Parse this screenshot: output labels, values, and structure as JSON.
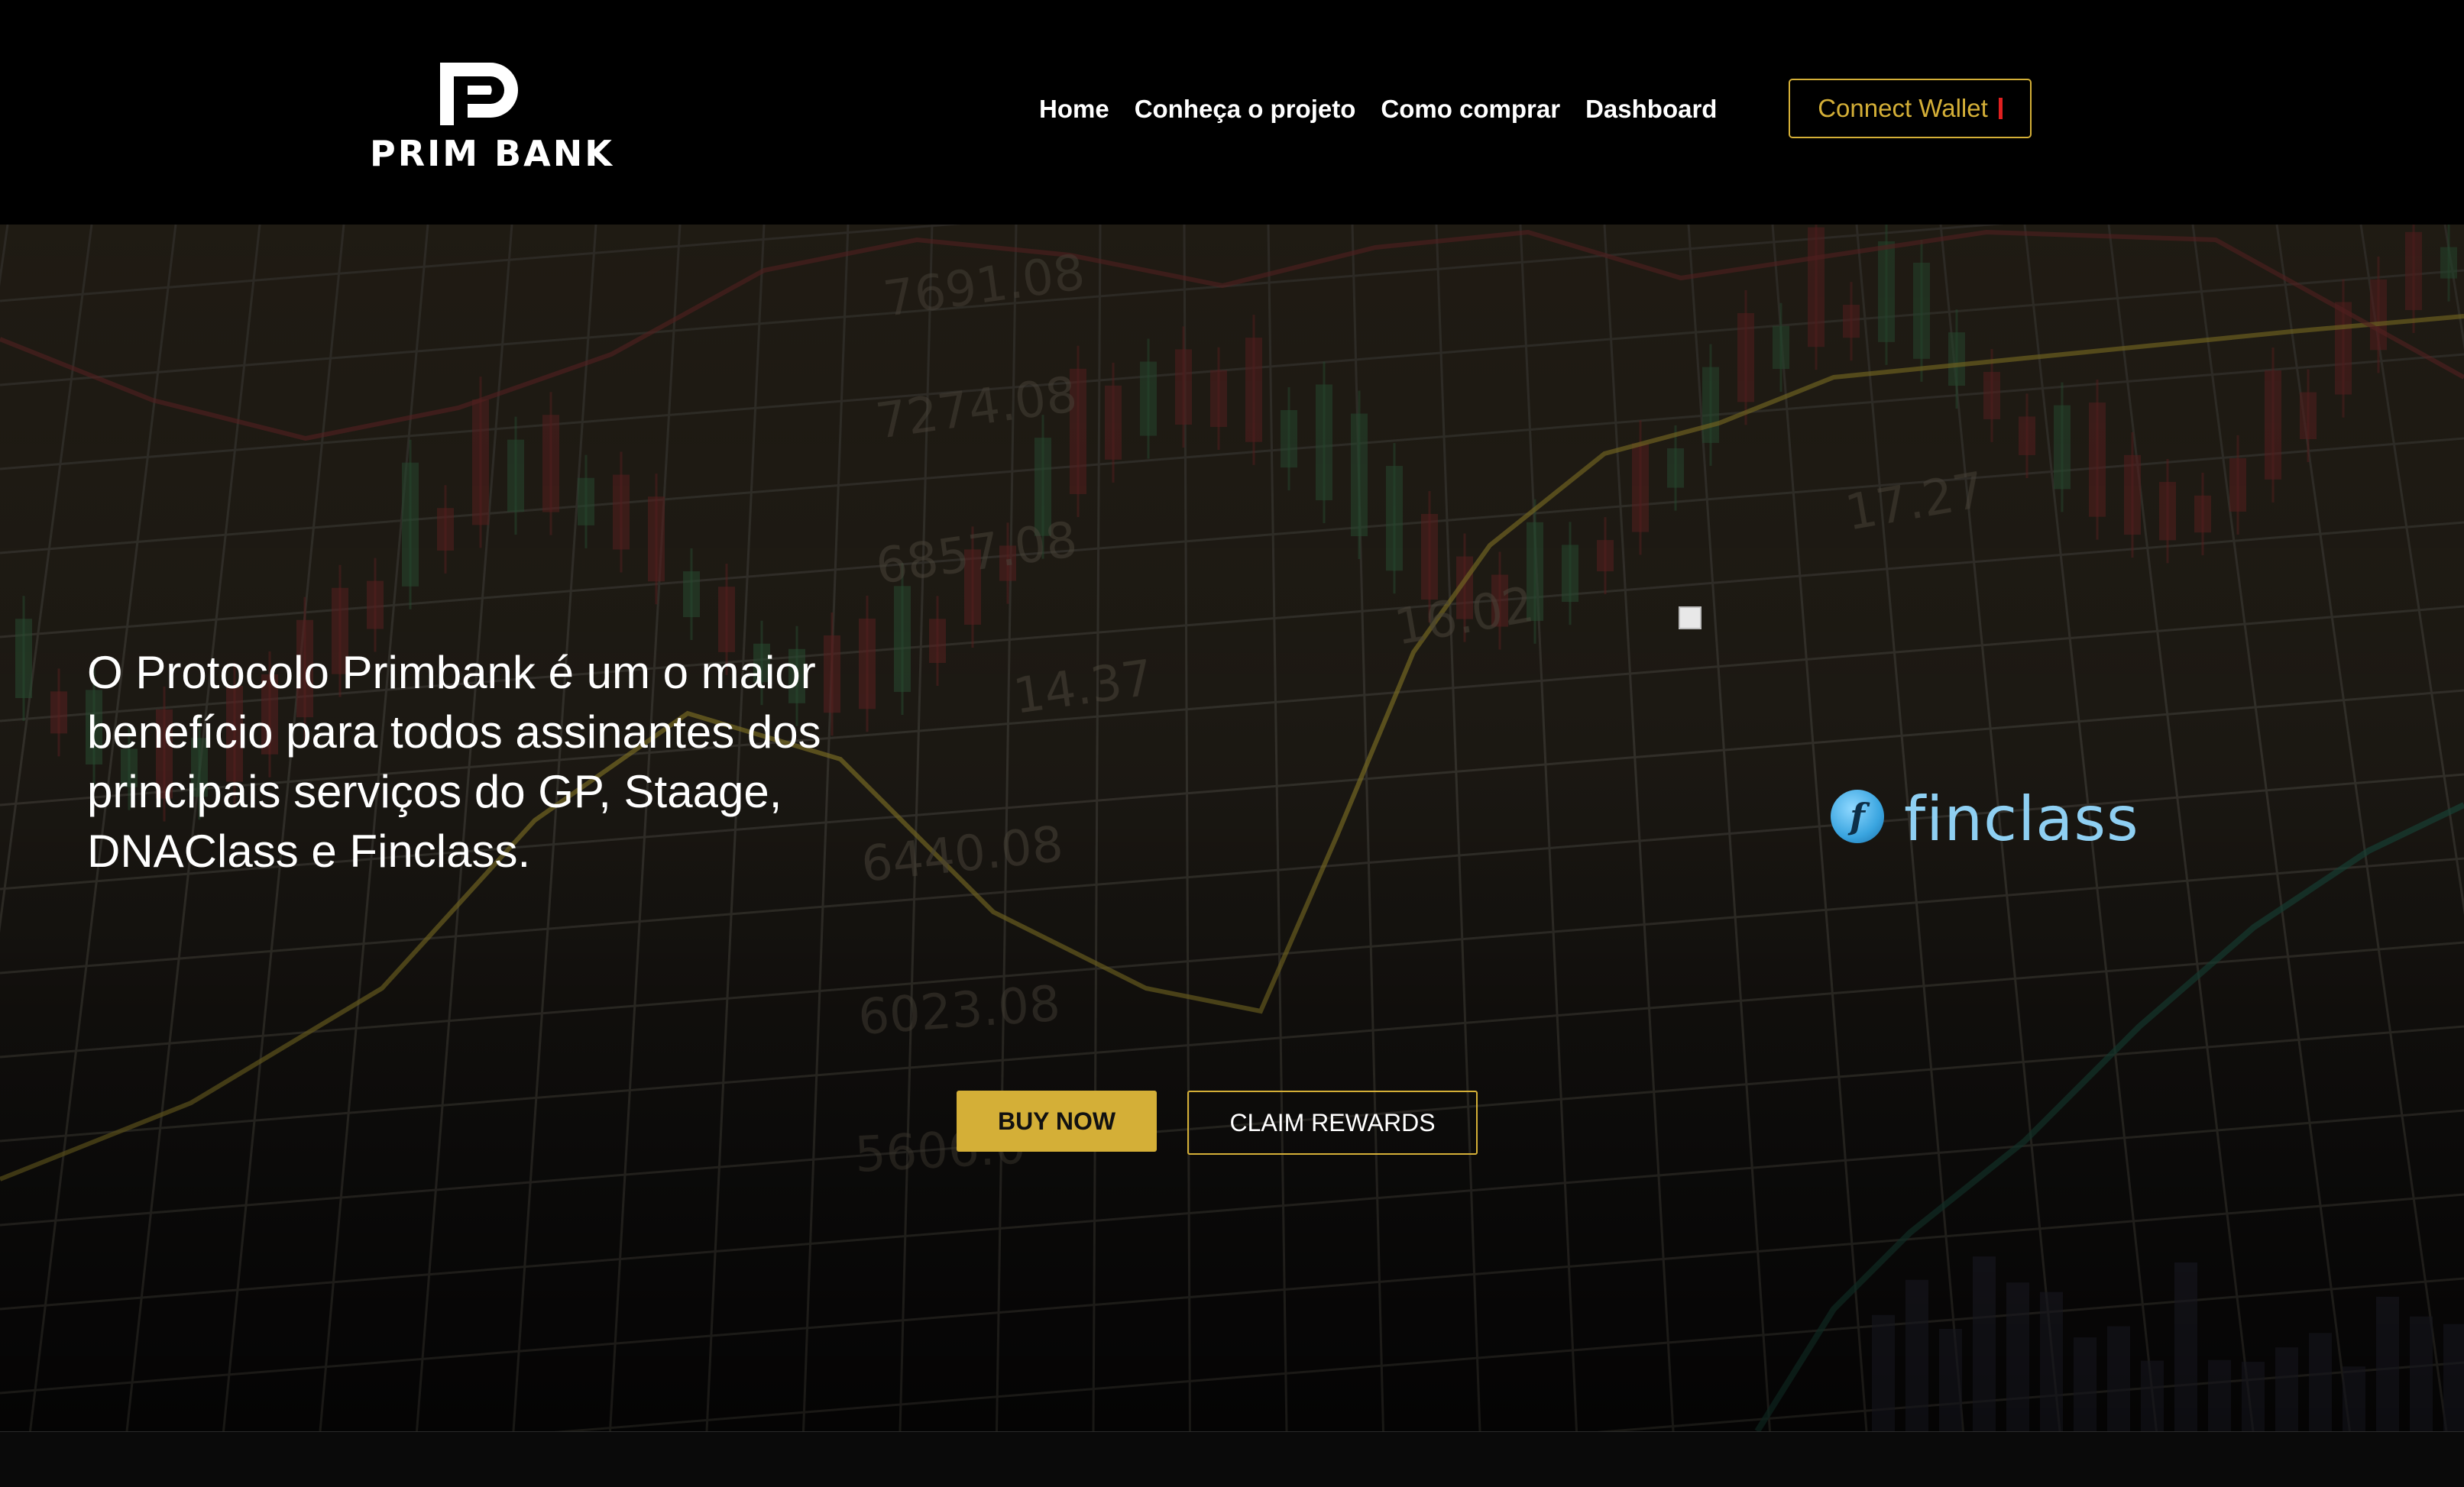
{
  "brand": {
    "name": "PRIM BANK",
    "logo_icon": "pb-monogram-icon"
  },
  "nav": {
    "items": [
      {
        "label": "Home"
      },
      {
        "label": "Conheça o projeto"
      },
      {
        "label": "Como comprar"
      },
      {
        "label": "Dashboard"
      }
    ],
    "wallet_button": "Connect Wallet"
  },
  "hero": {
    "text": "O Protocolo Primbank é um o maior benefício para todos assinantes dos principais serviços do GP, Staage, DNAClass e Finclass.",
    "partner": {
      "name": "finclass",
      "icon_letter": "f"
    },
    "buttons": {
      "buy": "BUY NOW",
      "claim": "CLAIM REWARDS"
    }
  },
  "colors": {
    "accent": "#d4af37",
    "header_bg": "#000000",
    "partner_blue": "#8ecff2",
    "status_red": "#e02020"
  }
}
